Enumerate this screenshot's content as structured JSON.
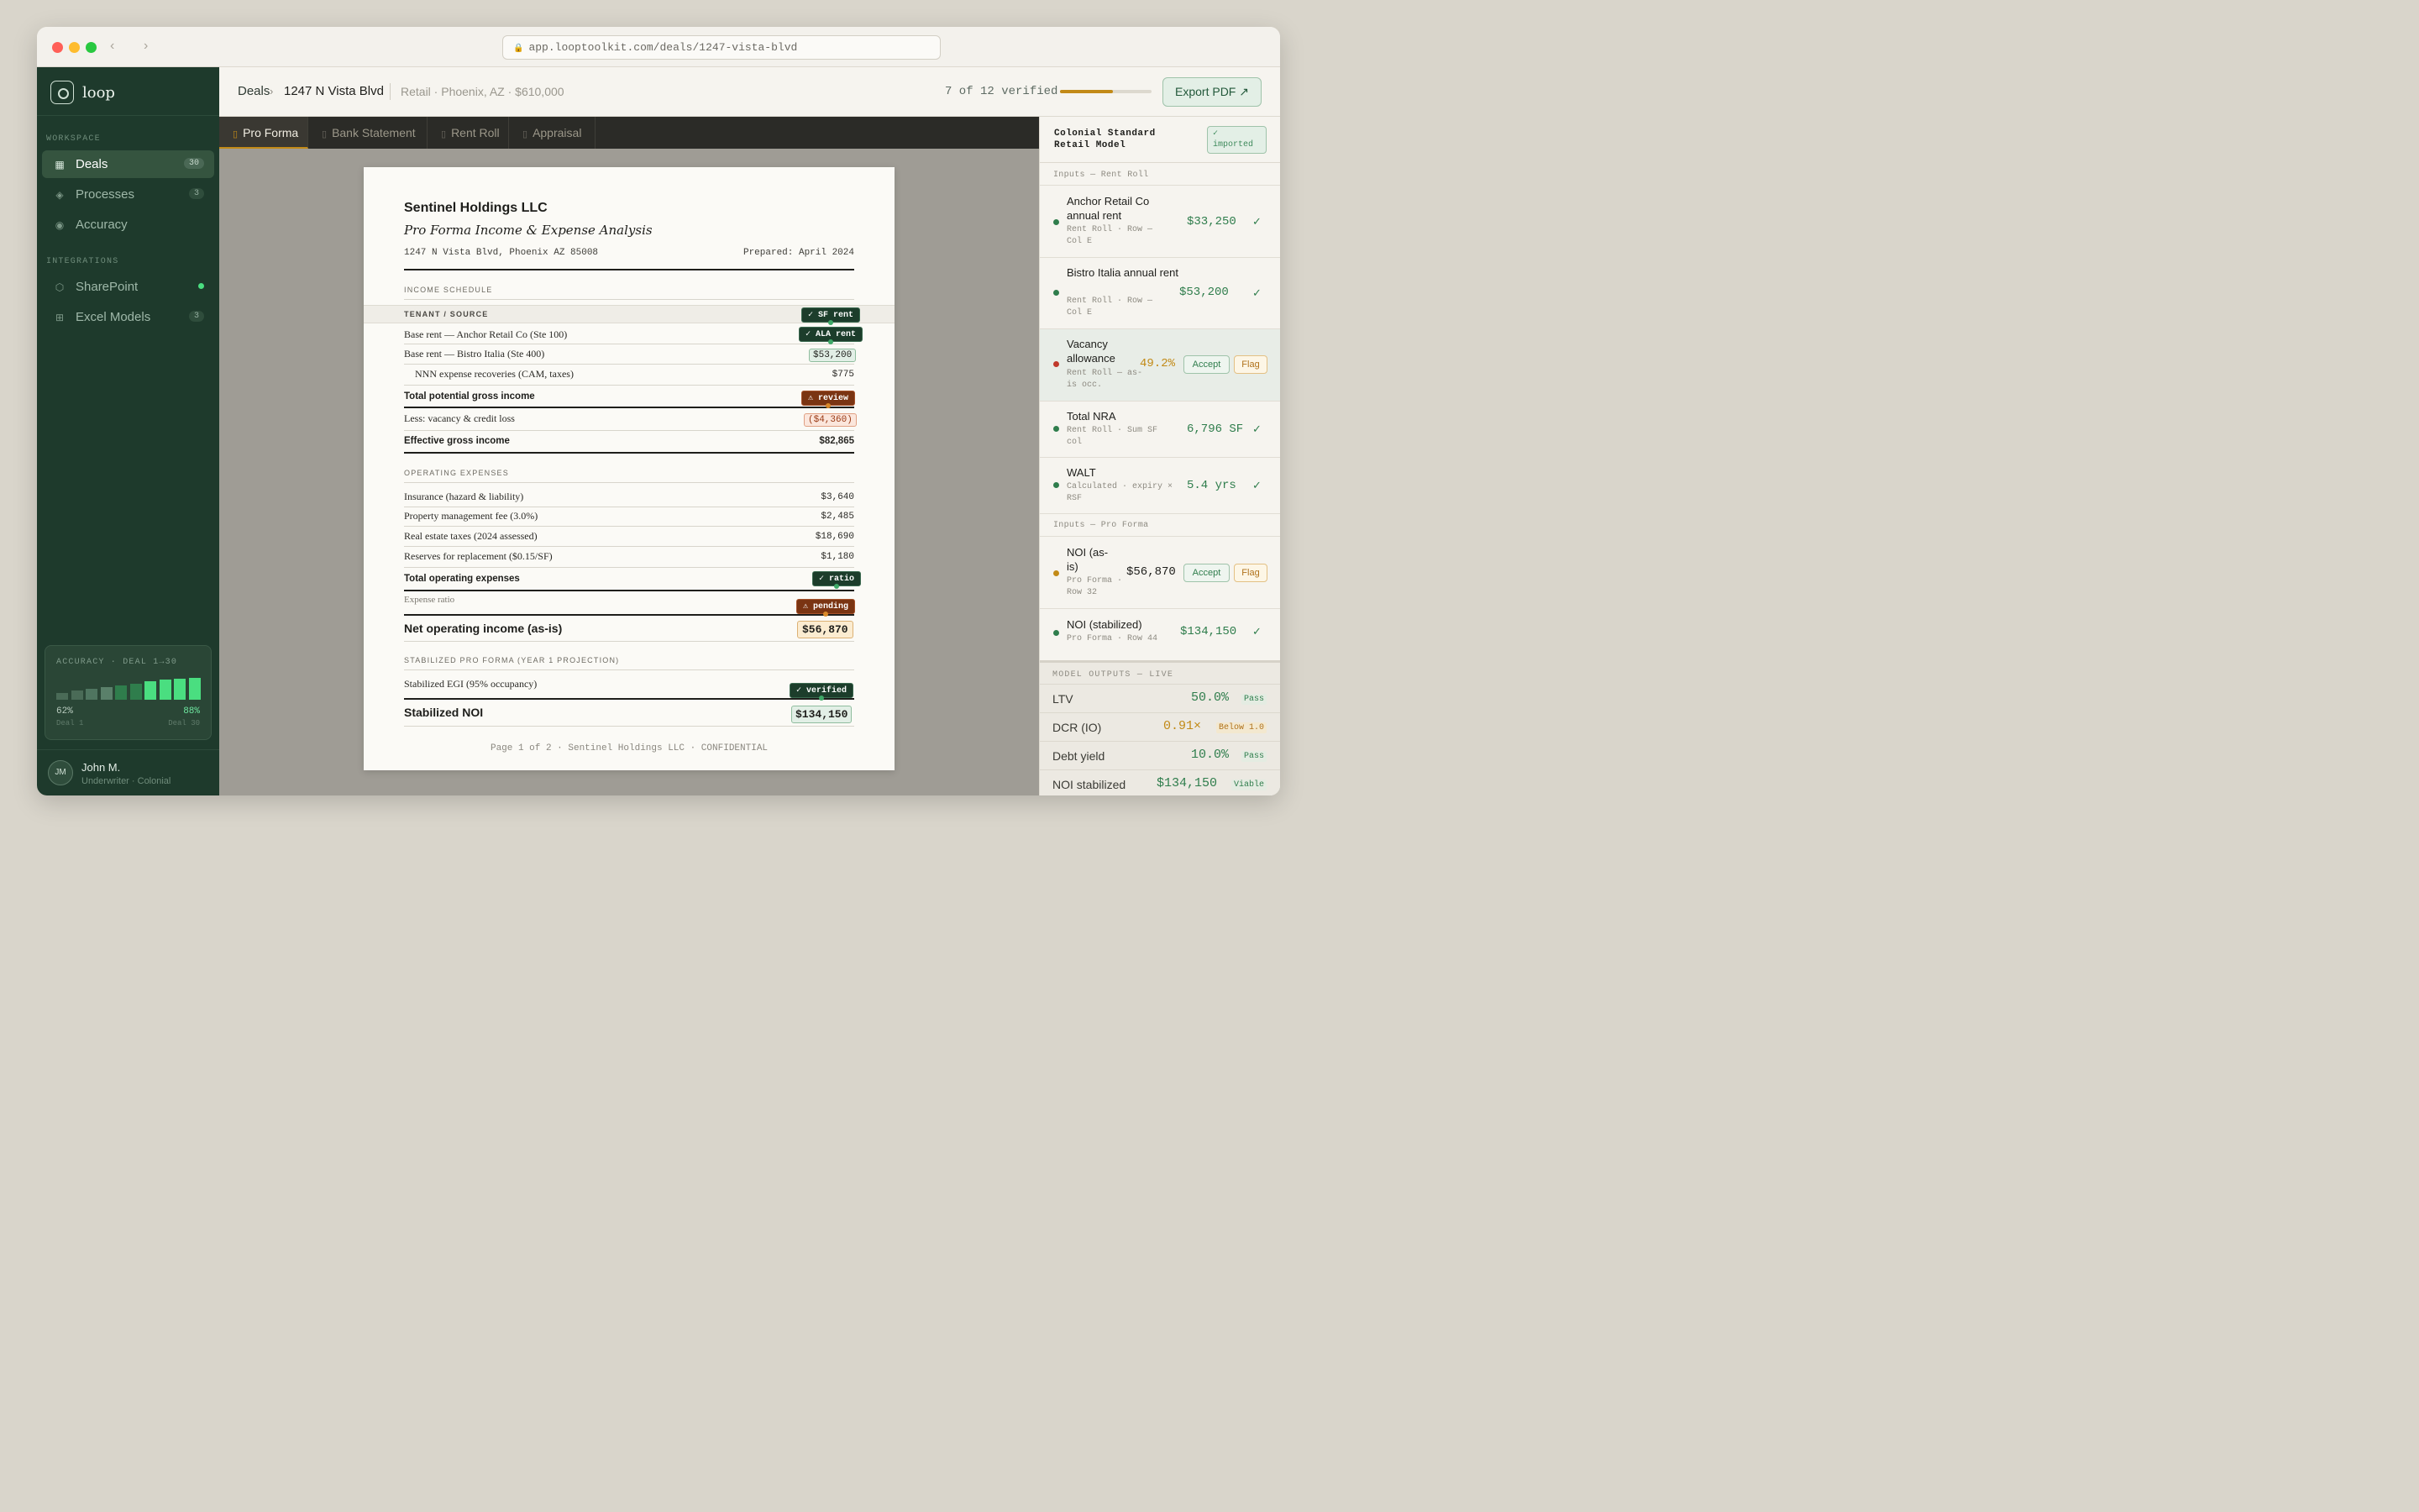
{
  "browser": {
    "url": "app.looptoolkit.com/deals/1247-vista-blvd",
    "back_glyph": "‹",
    "forward_glyph": "›",
    "lock_glyph": "🔒"
  },
  "colors": {
    "sidebar_bg": "#1e3a2c",
    "accent_amber": "#c28a17",
    "verified_green": "#2f7d4c",
    "warning_red": "#c0392b",
    "review_brown": "#7a3412"
  },
  "sidebar": {
    "logo_text": "loop",
    "workspace_label": "WORKSPACE",
    "integrations_label": "INTEGRATIONS",
    "workspace_items": [
      {
        "label": "Deals",
        "count": "30",
        "icon": "grid-icon",
        "glyph": "▦"
      },
      {
        "label": "Processes",
        "count": "3",
        "icon": "diamond-icon",
        "glyph": "◈"
      },
      {
        "label": "Accuracy",
        "count": "",
        "icon": "target-icon",
        "glyph": "◉"
      }
    ],
    "integration_items": [
      {
        "label": "SharePoint",
        "icon": "hexagon-icon",
        "glyph": "⬡",
        "status": "connected"
      },
      {
        "label": "Excel Models",
        "count": "3",
        "icon": "table-icon",
        "glyph": "⊞"
      }
    ],
    "accuracy": {
      "title": "ACCURACY · DEAL 1→30",
      "start_pct": "62%",
      "end_pct": "88%",
      "start_label": "Deal 1",
      "end_label": "Deal 30",
      "bars": [
        0.3,
        0.38,
        0.45,
        0.55,
        0.62,
        0.68,
        0.78,
        0.85,
        0.88,
        0.92
      ]
    },
    "user": {
      "initials": "JM",
      "name": "John M.",
      "role": "Underwriter · Colonial"
    }
  },
  "topbar": {
    "crumb_root": "Deals",
    "crumb_sep": "›",
    "crumb_current": "1247 N Vista Blvd",
    "meta": "Retail · Phoenix, AZ · $610,000",
    "verified_text": "7 of 12 verified",
    "verified_progress": 0.58,
    "export_label": "Export PDF ↗"
  },
  "tabs": [
    {
      "label": "Pro Forma",
      "icon_glyph": "▯"
    },
    {
      "label": "Bank Statement",
      "icon_glyph": "▯"
    },
    {
      "label": "Rent Roll",
      "icon_glyph": "▯"
    },
    {
      "label": "Appraisal",
      "icon_glyph": "▯"
    }
  ],
  "document": {
    "company": "Sentinel Holdings LLC",
    "subtitle": "Pro Forma Income & Expense Analysis",
    "address": "1247 N Vista Blvd, Phoenix AZ 85008",
    "prepared": "Prepared: April 2024",
    "income_header": "INCOME SCHEDULE",
    "tenant_header": "TENANT / SOURCE",
    "base_rent_anchor": "Base rent — Anchor Retail Co (Ste 100)",
    "base_rent_bistro": "Base rent — Bistro Italia (Ste 400)",
    "bistro_value": "$53,200",
    "nnn_label": "NNN expense recoveries (CAM, taxes)",
    "nnn_value": "$775",
    "tpgi_label": "Total potential gross income",
    "vacancy_label": "Less: vacancy & credit loss",
    "vacancy_value": "($4,360)",
    "egi_label": "Effective gross income",
    "egi_value": "$82,865",
    "opex_header": "OPERATING EXPENSES",
    "insurance_label": "Insurance (hazard & liability)",
    "insurance_value": "$3,640",
    "mgmt_label": "Property management fee (3.0%)",
    "mgmt_value": "$2,485",
    "taxes_label": "Real estate taxes (2024 assessed)",
    "taxes_value": "$18,690",
    "reserves_label": "Reserves for replacement ($0.15/SF)",
    "reserves_value": "$1,180",
    "total_opex_label": "Total operating expenses",
    "expense_ratio_label": "Expense ratio",
    "noi_label": "Net operating income (as-is)",
    "noi_value": "$56,870",
    "stab_header": "STABILIZED PRO FORMA (YEAR 1 PROJECTION)",
    "stab_egi_label": "Stabilized EGI (95% occupancy)",
    "stab_noi_label": "Stabilized NOI",
    "stab_noi_value": "$134,150",
    "footer": "Page 1 of 2 · Sentinel Holdings LLC · CONFIDENTIAL",
    "chips": {
      "sf_rent": "✓ SF rent",
      "ala_rent": "✓ ALA rent",
      "review": "⚠ review",
      "ratio": "✓ ratio",
      "pending": "⚠ pending",
      "verified": "✓ verified"
    }
  },
  "right_panel": {
    "model_name": "Colonial Standard Retail Model",
    "imported": "✓ imported",
    "rent_roll_section": "Inputs — Rent Roll",
    "pro_forma_section": "Inputs — Pro Forma",
    "accept_label": "Accept",
    "flag_label": "Flag",
    "check": "✓",
    "inputs": [
      {
        "name": "Anchor Retail Co annual rent",
        "source": "Rent Roll · Row — Col E",
        "value": "$33,250",
        "status": "verified"
      },
      {
        "name": "Bistro Italia annual rent",
        "source": "Rent Roll · Row — Col E",
        "value": "$53,200",
        "status": "verified"
      },
      {
        "name": "Vacancy allowance",
        "source": "Rent Roll — as-is occ.",
        "value": "49.2%",
        "status": "error"
      },
      {
        "name": "Total NRA",
        "source": "Rent Roll · Sum SF col",
        "value": "6,796 SF",
        "status": "verified"
      },
      {
        "name": "WALT",
        "source": "Calculated · expiry × RSF",
        "value": "5.4 yrs",
        "status": "verified"
      },
      {
        "name": "NOI (as-is)",
        "source": "Pro Forma · Row 32",
        "value": "$56,870",
        "status": "pending"
      },
      {
        "name": "NOI (stabilized)",
        "source": "Pro Forma · Row 44",
        "value": "$134,150",
        "status": "verified"
      }
    ],
    "outputs_title": "MODEL OUTPUTS — LIVE",
    "outputs": [
      {
        "label": "LTV",
        "value": "50.0%",
        "badge": "Pass"
      },
      {
        "label": "DCR (IO)",
        "value": "0.91×",
        "badge": "Below 1.0"
      },
      {
        "label": "Debt yield",
        "value": "10.0%",
        "badge": "Pass"
      },
      {
        "label": "NOI stabilized",
        "value": "$134,150",
        "badge": "Viable"
      }
    ]
  }
}
